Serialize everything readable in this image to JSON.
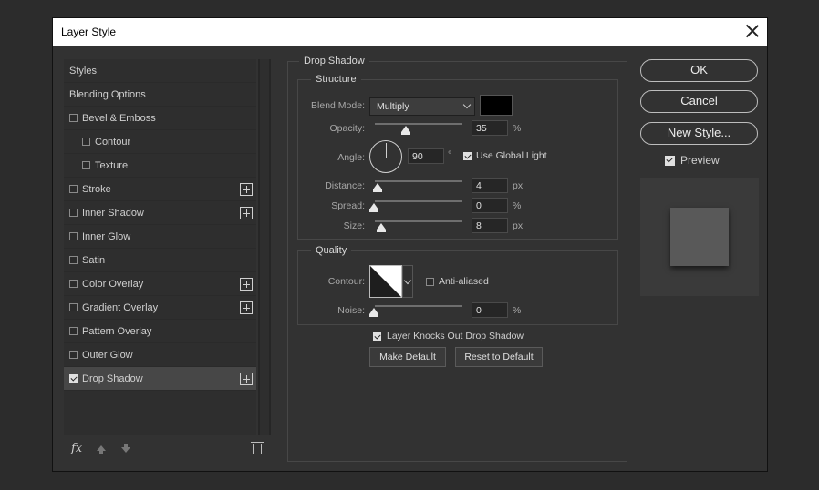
{
  "window": {
    "title": "Layer Style"
  },
  "styles_list": [
    {
      "label": "Styles",
      "checkbox": false,
      "indent": 0,
      "plus": false,
      "checked": false,
      "selected": false
    },
    {
      "label": "Blending Options",
      "checkbox": false,
      "indent": 0,
      "plus": false,
      "checked": false,
      "selected": false
    },
    {
      "label": "Bevel & Emboss",
      "checkbox": true,
      "indent": 0,
      "plus": false,
      "checked": false,
      "selected": false
    },
    {
      "label": "Contour",
      "checkbox": true,
      "indent": 1,
      "plus": false,
      "checked": false,
      "selected": false
    },
    {
      "label": "Texture",
      "checkbox": true,
      "indent": 1,
      "plus": false,
      "checked": false,
      "selected": false
    },
    {
      "label": "Stroke",
      "checkbox": true,
      "indent": 0,
      "plus": true,
      "checked": false,
      "selected": false
    },
    {
      "label": "Inner Shadow",
      "checkbox": true,
      "indent": 0,
      "plus": true,
      "checked": false,
      "selected": false
    },
    {
      "label": "Inner Glow",
      "checkbox": true,
      "indent": 0,
      "plus": false,
      "checked": false,
      "selected": false
    },
    {
      "label": "Satin",
      "checkbox": true,
      "indent": 0,
      "plus": false,
      "checked": false,
      "selected": false
    },
    {
      "label": "Color Overlay",
      "checkbox": true,
      "indent": 0,
      "plus": true,
      "checked": false,
      "selected": false
    },
    {
      "label": "Gradient Overlay",
      "checkbox": true,
      "indent": 0,
      "plus": true,
      "checked": false,
      "selected": false
    },
    {
      "label": "Pattern Overlay",
      "checkbox": true,
      "indent": 0,
      "plus": false,
      "checked": false,
      "selected": false
    },
    {
      "label": "Outer Glow",
      "checkbox": true,
      "indent": 0,
      "plus": false,
      "checked": false,
      "selected": false
    },
    {
      "label": "Drop Shadow",
      "checkbox": true,
      "indent": 0,
      "plus": true,
      "checked": true,
      "selected": true
    }
  ],
  "footer": {
    "fx_label": "fx"
  },
  "drop_shadow": {
    "section_title": "Drop Shadow",
    "structure": {
      "title": "Structure",
      "blend_mode_label": "Blend Mode:",
      "blend_mode_value": "Multiply",
      "shadow_color": "#000000",
      "opacity_label": "Opacity:",
      "opacity_value": "35",
      "opacity_fraction": 0.35,
      "opacity_unit": "%",
      "angle_label": "Angle:",
      "angle_value": "90",
      "angle_unit": "°",
      "use_global_light_label": "Use Global Light",
      "use_global_light_checked": true,
      "distance_label": "Distance:",
      "distance_value": "4",
      "distance_unit": "px",
      "spread_label": "Spread:",
      "spread_value": "0",
      "spread_unit": "%",
      "size_label": "Size:",
      "size_value": "8",
      "size_unit": "px"
    },
    "quality": {
      "title": "Quality",
      "contour_label": "Contour:",
      "anti_aliased_label": "Anti-aliased",
      "anti_aliased_checked": false,
      "noise_label": "Noise:",
      "noise_value": "0",
      "noise_unit": "%"
    },
    "layer_knocks_out_label": "Layer Knocks Out Drop Shadow",
    "layer_knocks_out_checked": true,
    "make_default_label": "Make Default",
    "reset_default_label": "Reset to Default"
  },
  "actions": {
    "ok_label": "OK",
    "cancel_label": "Cancel",
    "new_style_label": "New Style...",
    "preview_label": "Preview",
    "preview_checked": true
  }
}
